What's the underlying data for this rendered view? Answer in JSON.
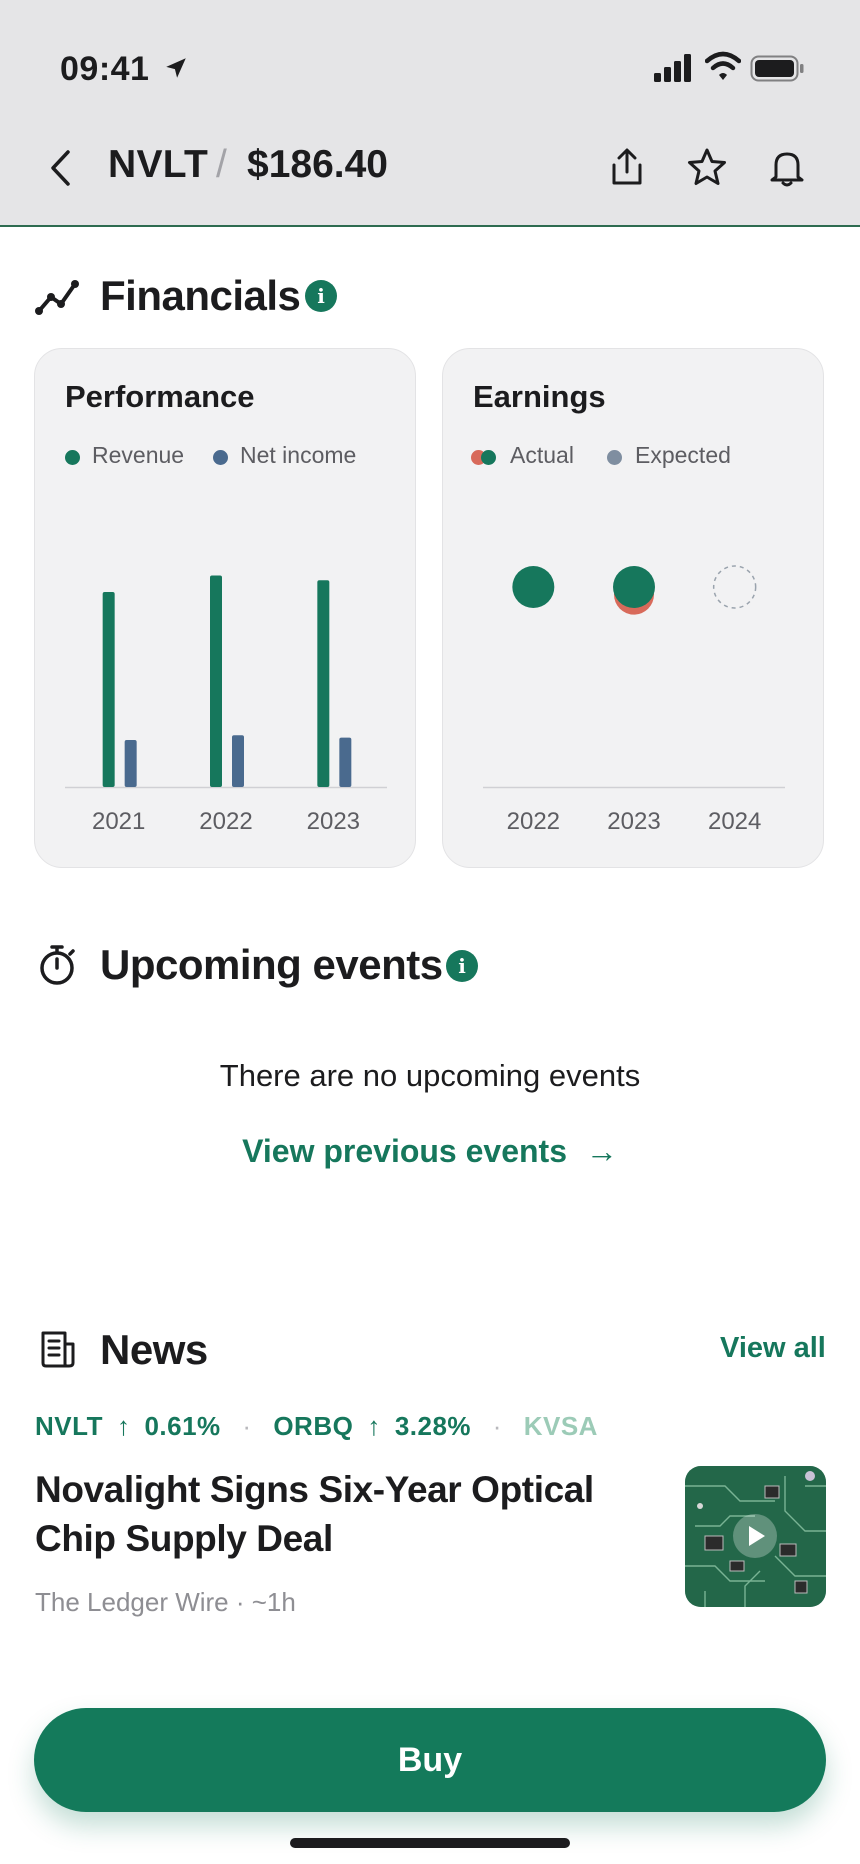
{
  "status_bar": {
    "time": "09:41"
  },
  "header": {
    "ticker": "NVLT",
    "separator": "/",
    "price": "$186.40"
  },
  "financials": {
    "title": "Financials",
    "info_glyph": "i",
    "performance": {
      "title": "Performance",
      "legend": [
        {
          "label": "Revenue",
          "color": "#16775c"
        },
        {
          "label": "Net income",
          "color": "#4a6a8e"
        }
      ]
    },
    "earnings": {
      "title": "Earnings",
      "legend": [
        {
          "label": "Actual",
          "colors": [
            "#d86a5a",
            "#16775c"
          ]
        },
        {
          "label": "Expected",
          "color": "#7f8ea0"
        }
      ]
    }
  },
  "chart_data": [
    {
      "type": "bar",
      "title": "Performance",
      "categories": [
        "2021",
        "2022",
        "2023"
      ],
      "series": [
        {
          "name": "Revenue",
          "values": [
            83,
            90,
            88
          ],
          "color": "#16775c"
        },
        {
          "name": "Net income",
          "values": [
            20,
            22,
            21
          ],
          "color": "#4a6a8e"
        }
      ],
      "ylim": [
        0,
        100
      ],
      "grid": false
    },
    {
      "type": "scatter",
      "title": "Earnings",
      "categories": [
        "2022",
        "2023",
        "2024"
      ],
      "series": [
        {
          "name": "Actual",
          "values": [
            1.0,
            1.0,
            null
          ],
          "color": "#16775c"
        },
        {
          "name": "Expected",
          "values": [
            1.0,
            1.08,
            1.0
          ],
          "color": "#d86a5a"
        }
      ],
      "grid": false
    }
  ],
  "events": {
    "title": "Upcoming events",
    "info_glyph": "i",
    "empty_message": "There are no upcoming events",
    "link_label": "View previous events",
    "link_arrow": "→"
  },
  "news": {
    "title": "News",
    "view_all": "View all",
    "tickers": [
      {
        "symbol": "NVLT",
        "arrow": "↑",
        "change": "0.61%"
      },
      {
        "symbol": "ORBQ",
        "arrow": "↑",
        "change": "3.28%"
      },
      {
        "symbol": "KVSA"
      }
    ],
    "dot": "·",
    "headline": "Novalight Signs Six-Year Optical Chip Supply Deal",
    "meta": "The Ledger Wire · ~1h"
  },
  "buy_button": {
    "label": "Buy"
  },
  "colors": {
    "accent": "#16775c",
    "header_bg": "#e5e5e7",
    "card_bg": "#f2f2f3"
  }
}
